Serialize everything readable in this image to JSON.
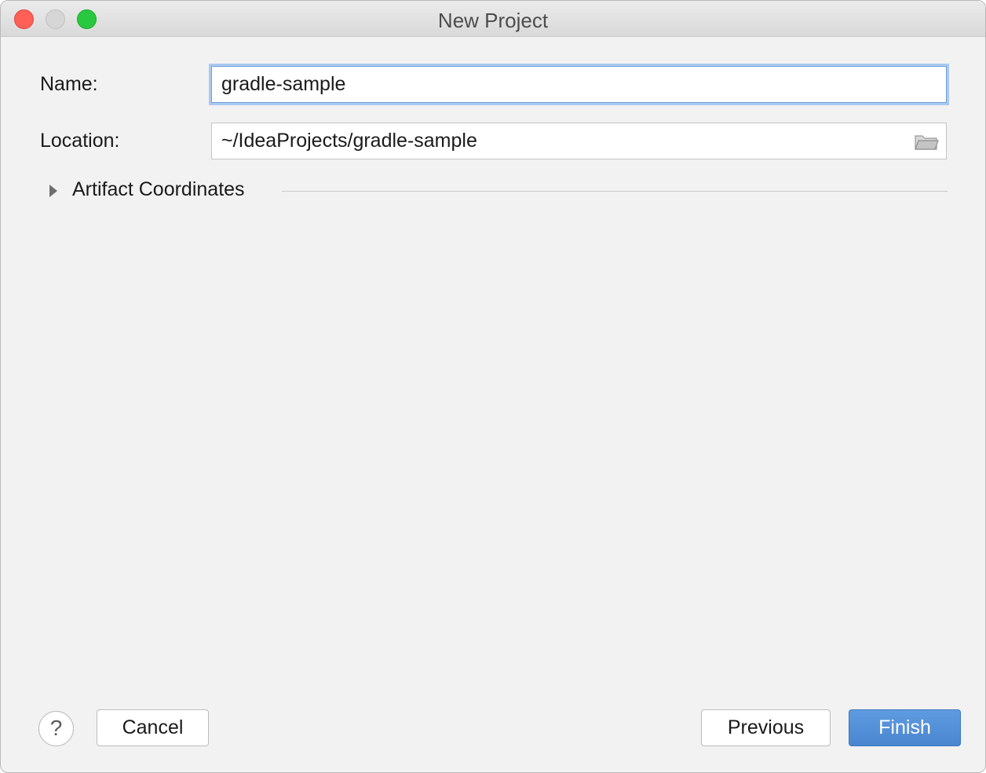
{
  "window": {
    "title": "New Project",
    "controls": [
      "close",
      "minimize",
      "zoom"
    ]
  },
  "form": {
    "name_label": "Name:",
    "name_value": "gradle-sample",
    "location_label": "Location:",
    "location_value": "~/IdeaProjects/gradle-sample",
    "location_icon": "folder-icon"
  },
  "section": {
    "title": "Artifact Coordinates",
    "icon": "disclosure-triangle-icon",
    "state": "collapsed"
  },
  "footer": {
    "help_label": "?",
    "cancel_label": "Cancel",
    "previous_label": "Previous",
    "finish_label": "Finish"
  },
  "colors": {
    "accent": "#4a86d0",
    "focus_ring": "#a9c9f0",
    "background": "#f2f2f2"
  }
}
